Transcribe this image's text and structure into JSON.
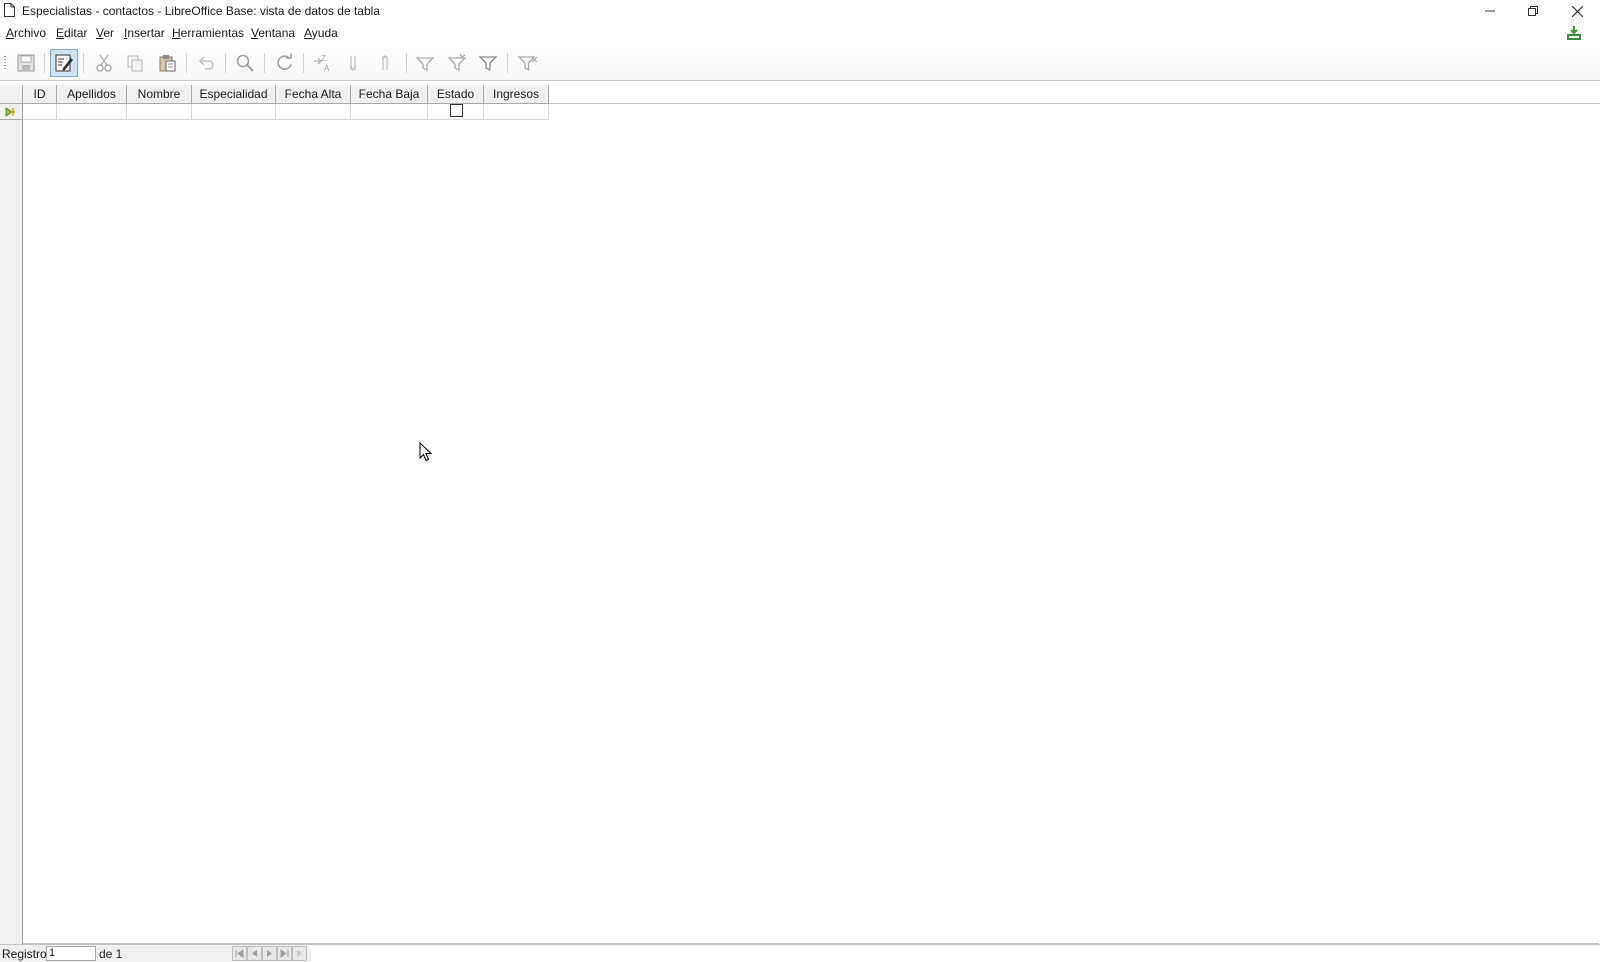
{
  "window": {
    "title": "Especialistas - contactos - LibreOffice Base: vista de datos de tabla"
  },
  "menu": [
    {
      "label": "Archivo",
      "accel": "A",
      "rest": "rchivo"
    },
    {
      "label": "Editar",
      "accel": "E",
      "rest": "ditar"
    },
    {
      "label": "Ver",
      "accel": "V",
      "rest": "er"
    },
    {
      "label": "Insertar",
      "accel": "I",
      "rest": "nsertar"
    },
    {
      "label": "Herramientas",
      "accel": "H",
      "rest": "erramientas"
    },
    {
      "label": "Ventana",
      "accel": "V",
      "rest": "entana"
    },
    {
      "label": "Ayuda",
      "accel": "A",
      "rest": "yuda"
    }
  ],
  "toolbar": {
    "icons": [
      "save-icon",
      "edit-data-icon",
      "cut-icon",
      "copy-icon",
      "paste-icon",
      "undo-icon",
      "find-icon",
      "refresh-icon",
      "sort-icon",
      "sort-ascending-icon",
      "sort-descending-icon",
      "autofilter-icon",
      "apply-filter-icon",
      "standard-filter-icon",
      "reset-filter-icon"
    ],
    "edit_active": true
  },
  "table": {
    "columns": [
      "ID",
      "Apellidos",
      "Nombre",
      "Especialidad",
      "Fecha Alta",
      "Fecha Baja",
      "Estado",
      "Ingresos"
    ],
    "rows": [
      {
        "ID": "",
        "Apellidos": "",
        "Nombre": "",
        "Especialidad": "",
        "Fecha Alta": "",
        "Fecha Baja": "",
        "Estado": false,
        "Ingresos": ""
      }
    ]
  },
  "statusbar": {
    "record_label": "Registro",
    "record_value": "1",
    "of_label": "de 1"
  },
  "colors": {
    "header_bg": "#f0f0f0",
    "active_tool_bg": "#cfe4f6",
    "row_marker": "#8cc63f"
  }
}
